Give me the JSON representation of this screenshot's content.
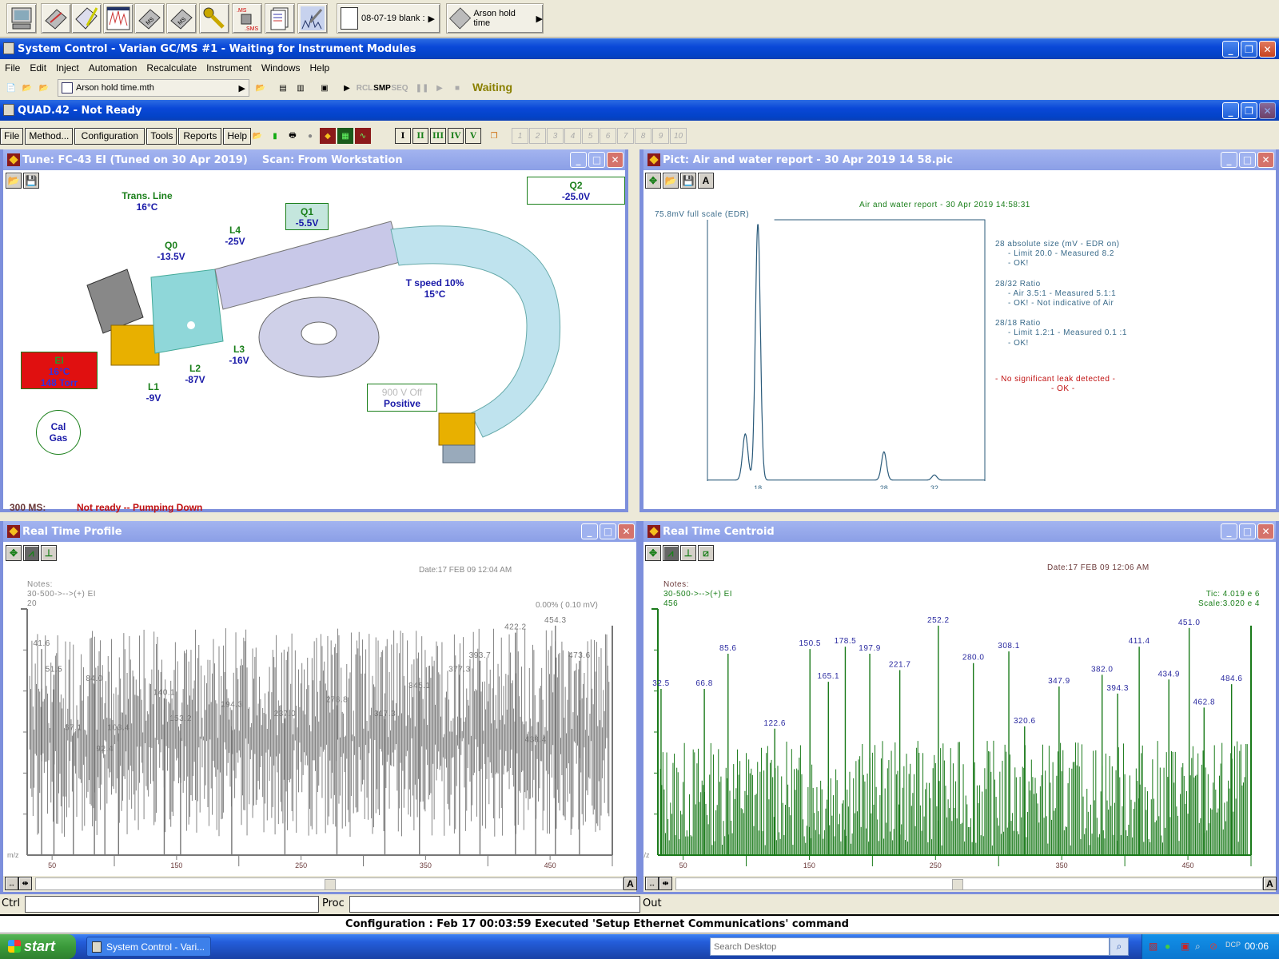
{
  "launcher": {
    "icons": [
      "system-control-icon",
      "method-builder-icon",
      "sample-list-icon",
      "review-chromatograms-icon",
      "ms-spectra-icon",
      "ms-custom-icon",
      "security-key-icon",
      "ms-convert-icon",
      "reports-icon",
      "calibrate-icon"
    ],
    "recent1": "08-07-19 blank :",
    "recent2": "Arson hold time"
  },
  "main_window": {
    "title": "System Control - Varian GC/MS #1 - Waiting for Instrument Modules",
    "menu": [
      "File",
      "Edit",
      "Inject",
      "Automation",
      "Recalculate",
      "Instrument",
      "Windows",
      "Help"
    ],
    "method_file": "Arson hold time.mth",
    "status": "Waiting",
    "toolbar_labels": {
      "rcl": "RCL",
      "smp": "SMP",
      "seq": "SEQ"
    }
  },
  "quad_window": {
    "title": "QUAD.42 - Not Ready",
    "menu": [
      "File",
      "Method...",
      "Configuration",
      "Tools",
      "Reports",
      "Help"
    ],
    "roman": [
      "I",
      "II",
      "III",
      "IV",
      "V"
    ],
    "numbered": [
      "1",
      "2",
      "3",
      "4",
      "5",
      "6",
      "7",
      "8",
      "9",
      "10"
    ]
  },
  "tune": {
    "title": "Tune: FC-43 EI (Tuned on 30 Apr 2019)    Scan: From Workstation",
    "trans_line": {
      "label": "Trans. Line",
      "value": "16°C"
    },
    "q0": {
      "label": "Q0",
      "value": "-13.5V"
    },
    "q1": {
      "label": "Q1",
      "value": "-5.5V"
    },
    "q2": {
      "label": "Q2",
      "value": "-25.0V"
    },
    "l1": {
      "label": "L1",
      "value": "-9V"
    },
    "l2": {
      "label": "L2",
      "value": "-87V"
    },
    "l3": {
      "label": "L3",
      "value": "-16V"
    },
    "l4": {
      "label": "L4",
      "value": "-25V"
    },
    "ei": {
      "label": "EI",
      "temp": "16°C",
      "pressure": "148 Torr"
    },
    "tspeed": {
      "line1": "T speed 10%",
      "line2": "15°C"
    },
    "detector": {
      "line1": "900 V  Off",
      "line2": "Positive"
    },
    "calgas": {
      "line1": "Cal",
      "line2": "Gas"
    },
    "ms_label": "300 MS:",
    "ms_status": "Not ready -- Pumping Down"
  },
  "pict": {
    "title": "Pict: Air and water report - 30 Apr 2019 14 58.pic",
    "report_title": "Air and water report - 30 Apr 2019 14:58:31",
    "fullscale": "75.8mV full scale (EDR)",
    "results": [
      {
        "text": "28 absolute size (mV - EDR on)",
        "indent": false,
        "color": "#3a6b8a"
      },
      {
        "text": "- Limit 20.0 - Measured 8.2",
        "indent": true,
        "color": "#3a6b8a"
      },
      {
        "text": "- OK!",
        "indent": true,
        "color": "#3a6b8a"
      },
      {
        "text": "28/32 Ratio",
        "indent": false,
        "color": "#3a6b8a"
      },
      {
        "text": "- Air 3.5:1 - Measured 5.1:1",
        "indent": true,
        "color": "#3a6b8a"
      },
      {
        "text": "- OK! - Not indicative of Air",
        "indent": true,
        "color": "#3a6b8a"
      },
      {
        "text": "28/18 Ratio",
        "indent": false,
        "color": "#3a6b8a"
      },
      {
        "text": "- Limit 1.2:1 - Measured 0.1 :1",
        "indent": true,
        "color": "#3a6b8a"
      },
      {
        "text": "- OK!",
        "indent": true,
        "color": "#3a6b8a"
      }
    ],
    "conclusion1": "- No significant leak detected -",
    "conclusion2": "- OK -"
  },
  "chart_data": [
    {
      "type": "line",
      "title": "Air and water report - 30 Apr 2019 14:58:31",
      "ylabel": "75.8mV full scale (EDR)",
      "xlabel": "m/z",
      "x_tick_labels": [
        "18",
        "28",
        "32"
      ],
      "peaks": [
        {
          "mz": 17,
          "relative": 0.18
        },
        {
          "mz": 18,
          "relative": 1.0
        },
        {
          "mz": 28,
          "relative": 0.11
        },
        {
          "mz": 32,
          "relative": 0.02
        }
      ],
      "xlim": [
        14,
        36
      ],
      "ylim": [
        0,
        1
      ]
    },
    {
      "type": "bar",
      "title": "Real Time Profile",
      "date": "Date:17 FEB 09  12:04 AM",
      "notes": [
        "Notes:",
        "30-500->-->(+)  EI",
        "20"
      ],
      "scale_note": "0.00% (   0.10 mV)",
      "xlabel": "m/z",
      "xlim": [
        30,
        500
      ],
      "x_ticks": [
        50,
        150,
        250,
        350,
        450
      ],
      "labeled_peaks": [
        {
          "mz": 41.6,
          "rel": 0.88
        },
        {
          "mz": 51.5,
          "rel": 0.77
        },
        {
          "mz": 67.1,
          "rel": 0.52
        },
        {
          "mz": 84.0,
          "rel": 0.73
        },
        {
          "mz": 92.4,
          "rel": 0.43
        },
        {
          "mz": 103.4,
          "rel": 0.52
        },
        {
          "mz": 140.1,
          "rel": 0.67
        },
        {
          "mz": 153.2,
          "rel": 0.56
        },
        {
          "mz": 194.3,
          "rel": 0.62
        },
        {
          "mz": 237.0,
          "rel": 0.58
        },
        {
          "mz": 278.8,
          "rel": 0.64
        },
        {
          "mz": 317.3,
          "rel": 0.58
        },
        {
          "mz": 345.1,
          "rel": 0.7
        },
        {
          "mz": 377.3,
          "rel": 0.77
        },
        {
          "mz": 393.7,
          "rel": 0.83
        },
        {
          "mz": 422.2,
          "rel": 0.95
        },
        {
          "mz": 438.4,
          "rel": 0.47
        },
        {
          "mz": 454.3,
          "rel": 0.98
        },
        {
          "mz": 473.6,
          "rel": 0.83
        }
      ]
    },
    {
      "type": "bar",
      "title": "Real Time Centroid",
      "date": "Date:17 FEB 09  12:06 AM",
      "notes": [
        "Notes:",
        "30-500->-->(+)  EI",
        "456"
      ],
      "tic": "Tic: 4.019 e 6",
      "scale": "Scale:3.020 e 4",
      "xlabel": "m/z",
      "xlim": [
        30,
        500
      ],
      "x_ticks": [
        50,
        150,
        250,
        350,
        450
      ],
      "labeled_peaks": [
        {
          "mz": 32.5,
          "rel": 0.71
        },
        {
          "mz": 66.8,
          "rel": 0.71
        },
        {
          "mz": 85.6,
          "rel": 0.86
        },
        {
          "mz": 122.6,
          "rel": 0.54
        },
        {
          "mz": 150.5,
          "rel": 0.88
        },
        {
          "mz": 165.1,
          "rel": 0.74
        },
        {
          "mz": 178.5,
          "rel": 0.89
        },
        {
          "mz": 197.9,
          "rel": 0.86
        },
        {
          "mz": 221.7,
          "rel": 0.79
        },
        {
          "mz": 252.2,
          "rel": 0.98
        },
        {
          "mz": 280.0,
          "rel": 0.82
        },
        {
          "mz": 308.1,
          "rel": 0.87
        },
        {
          "mz": 320.6,
          "rel": 0.55
        },
        {
          "mz": 347.9,
          "rel": 0.72
        },
        {
          "mz": 382.0,
          "rel": 0.77
        },
        {
          "mz": 394.3,
          "rel": 0.69
        },
        {
          "mz": 411.4,
          "rel": 0.89
        },
        {
          "mz": 434.9,
          "rel": 0.75
        },
        {
          "mz": 451.0,
          "rel": 0.97
        },
        {
          "mz": 462.8,
          "rel": 0.63
        },
        {
          "mz": 484.6,
          "rel": 0.73
        }
      ]
    }
  ],
  "profile": {
    "title": "Real Time Profile"
  },
  "centroid": {
    "title": "Real Time Centroid"
  },
  "cmd": {
    "ctrl": "Ctrl",
    "proc": "Proc",
    "out": "Out",
    "ctrl_value": "",
    "proc_value": ""
  },
  "status_message": "Configuration : Feb 17 00:03:59  Executed 'Setup Ethernet Communications' command",
  "taskbar": {
    "start": "start",
    "task": "System Control - Vari...",
    "search_placeholder": "Search Desktop",
    "clock": "00:06"
  }
}
